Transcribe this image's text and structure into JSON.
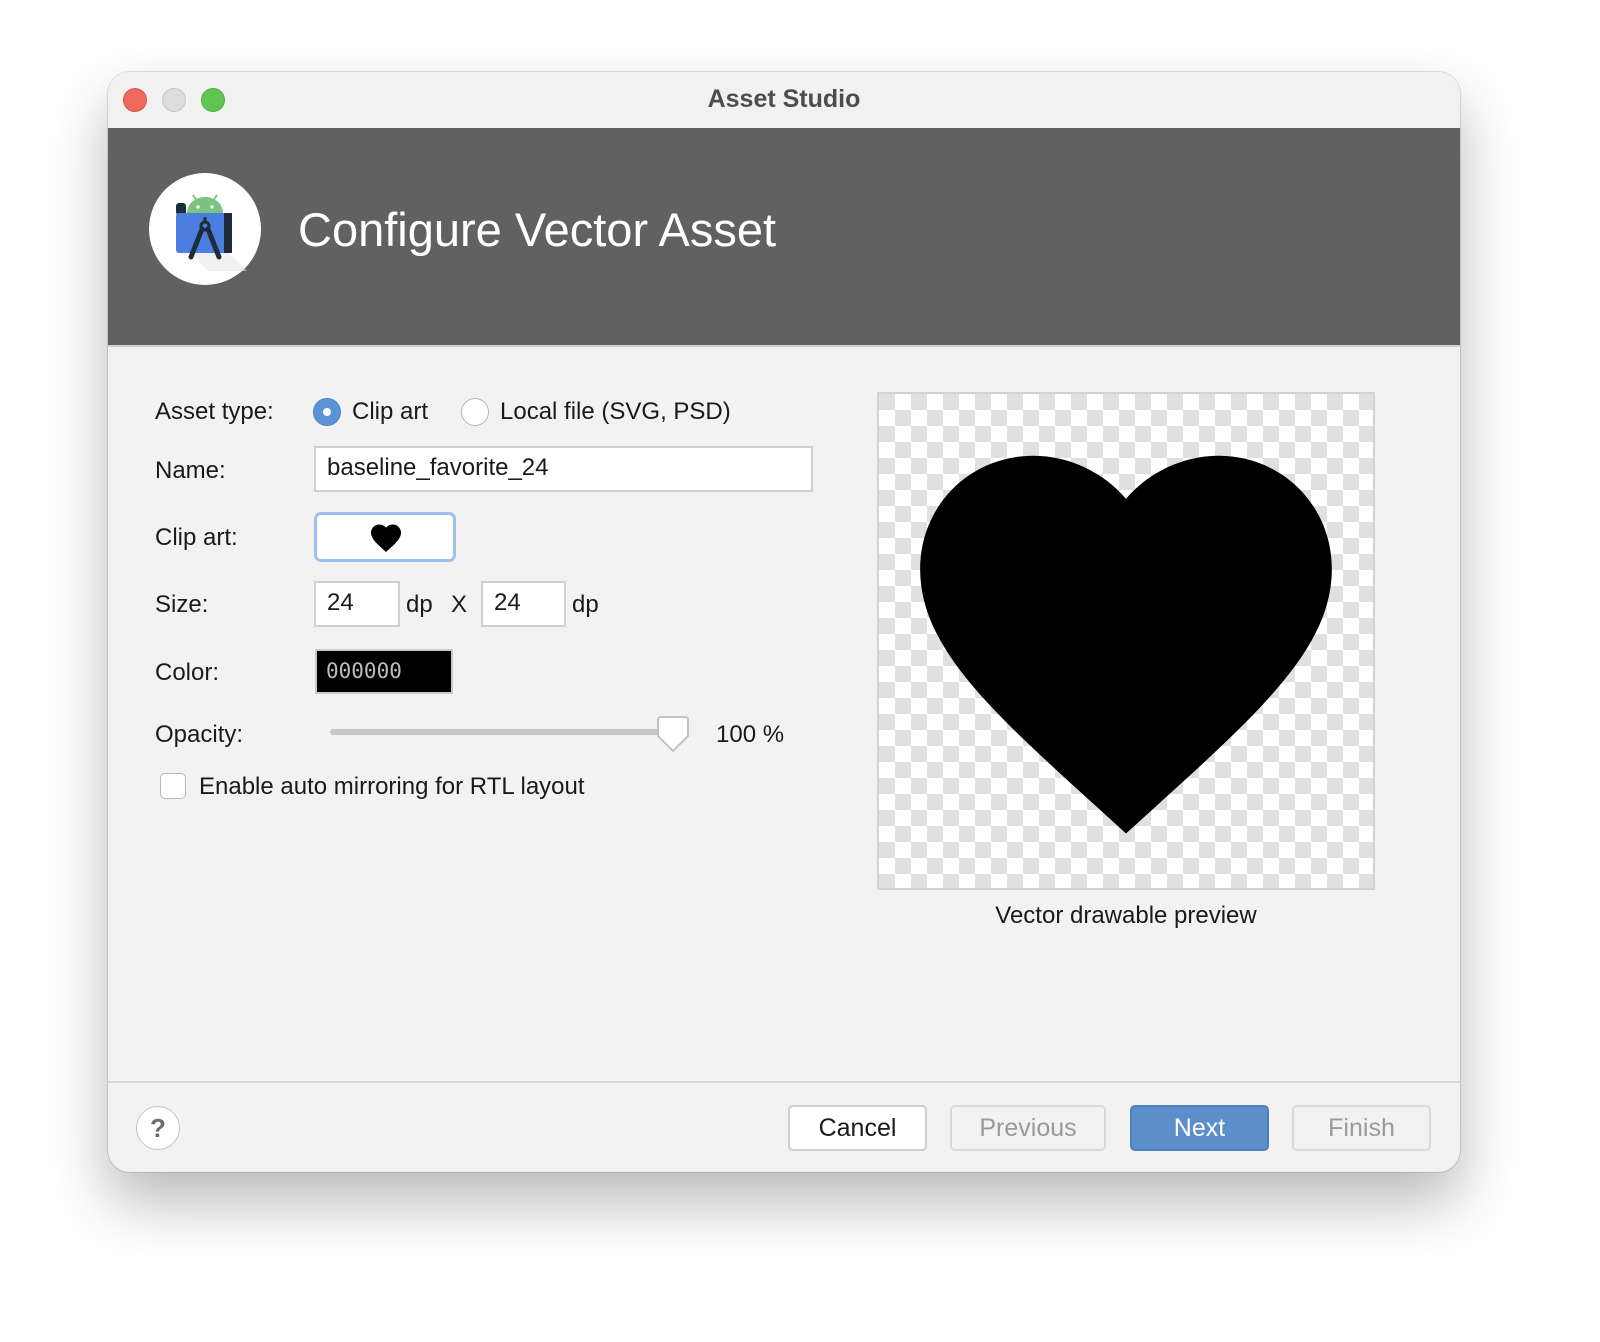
{
  "window": {
    "title": "Asset Studio"
  },
  "header": {
    "title": "Configure Vector Asset",
    "logo": "android-studio-logo-icon"
  },
  "form": {
    "asset_type": {
      "label": "Asset type:",
      "options": [
        {
          "label": "Clip art",
          "selected": true
        },
        {
          "label": "Local file (SVG, PSD)",
          "selected": false
        }
      ]
    },
    "name": {
      "label": "Name:",
      "value": "baseline_favorite_24"
    },
    "clip_art": {
      "label": "Clip art:",
      "icon": "heart-icon"
    },
    "size": {
      "label": "Size:",
      "width": "24",
      "height": "24",
      "unit": "dp",
      "separator": "X"
    },
    "color": {
      "label": "Color:",
      "value": "000000",
      "swatch": "#000000"
    },
    "opacity": {
      "label": "Opacity:",
      "value_percent": 100,
      "display": "100 %"
    },
    "auto_mirror": {
      "label": "Enable auto mirroring for RTL layout",
      "checked": false
    }
  },
  "preview": {
    "caption": "Vector drawable preview",
    "icon": "heart-icon"
  },
  "footer": {
    "help": "?",
    "cancel": "Cancel",
    "previous": "Previous",
    "next": "Next",
    "finish": "Finish"
  },
  "colors": {
    "header_bg": "#616161",
    "accent": "#5c8ecb",
    "focus_ring": "#9dc0ee"
  }
}
